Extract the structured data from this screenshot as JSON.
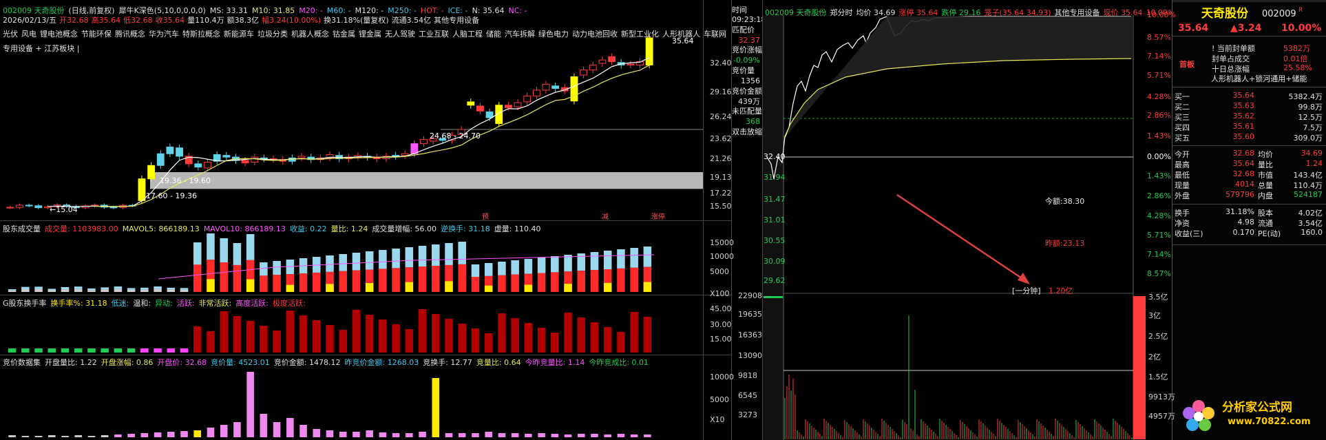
{
  "kline": {
    "header_line1": [
      "002009 天奇股份",
      "(日线,前复权)",
      "犀牛K深色(5,10,0,0,0,0)",
      "MS: 33.31",
      "M10: 31.85",
      "M20: -",
      "M60: -",
      "M120: -",
      "M250: -",
      "HOT: -",
      "ICE: -",
      "N: 35.64",
      "NC: -"
    ],
    "header_line2": [
      "2026/02/13/五",
      "开32.68",
      "高35.64",
      "低32.68",
      "收35.64",
      "量110.4万",
      "额38.3亿",
      "幅3.24(10.00%)",
      "换31.18%(量复权)",
      "流通3.54亿",
      "其他专用设备"
    ],
    "concepts": [
      "光伏",
      "风电",
      "锂电池概念",
      "节能环保",
      "腾讯概念",
      "华为汽车",
      "特斯拉概念",
      "新能源车",
      "垃圾分类",
      "机器人概念",
      "钴金属",
      "锂金属",
      "无人驾驶",
      "工业互联",
      "人脑工程",
      "储能",
      "汽车拆解",
      "绿色电力",
      "动力电池回收",
      "新型工业化",
      "人形机器人",
      "车联网"
    ],
    "concepts2": "专用设备 + 江苏板块 |",
    "price_axis": [
      "32.40",
      "29.16",
      "26.24",
      "23.62",
      "21.26",
      "19.13",
      "17.22",
      "15.50"
    ],
    "annotations": {
      "hi": "35.64",
      "lo": "15.04",
      "zone1": "24.68 - 24.70",
      "zone2": "19.36 - 19.60",
      "zone3": "17.60 - 19.36"
    },
    "markers": [
      "预",
      "减",
      "涨停"
    ],
    "colors": {
      "up": "#ff3b3b",
      "down": "#5fd3e8",
      "limit": "#ffff00",
      "ma5": "#ffffff",
      "ma10": "#e8e85a"
    }
  },
  "volume": {
    "title": [
      "股东成交量",
      "成交量: 1103983.00",
      "MAVOL5: 866189.13",
      "MAVOL10: 866189.13",
      "收益: 0.22",
      "量比: 1.24",
      "成交量增幅: 56.00",
      "逆换手: 31.18",
      "虚量: 110.40"
    ],
    "axis": [
      "15000",
      "10000",
      "5000",
      "X100"
    ]
  },
  "turnover": {
    "title": [
      "G股东换手率",
      "换手率%: 31.18",
      "低迷:",
      "温和:",
      "异动:",
      "活跃:",
      "非常活跃:",
      "高度活跃:",
      "极度活跃:"
    ],
    "axis": [
      "45.00",
      "30.00",
      "15.00"
    ]
  },
  "auction": {
    "title": [
      "竞价数据集",
      "开盘量比: 1.22",
      "开盘涨幅: 0.86",
      "开盘价: 32.68",
      "竞价量: 4523.01",
      "竞价金额: 1478.12",
      "昨竞价金额: 1268.03",
      "竞换手: 12.77",
      "竞量比: 0.64",
      "今昨竞量比: 1.14",
      "今昨竞成比: 0.01"
    ],
    "axis": [
      "10000",
      "5000",
      "X10"
    ]
  },
  "auction_panel": {
    "time_label": "时间",
    "time": "09:23:18",
    "items": [
      {
        "k": "匹配价",
        "v": "32.37"
      },
      {
        "k": "竞价涨幅",
        "v": "-0.09%"
      },
      {
        "k": "竞价量",
        "v": "1356"
      },
      {
        "k": "竞价金额",
        "v": "439万"
      },
      {
        "k": "未匹配量",
        "v": "368"
      },
      {
        "k": "双击放缩",
        "v": ""
      }
    ]
  },
  "intraday": {
    "header": [
      "002009 天奇股份",
      "郑分时",
      "均价 34.69",
      "涨停 35.64",
      "跌停 29.16",
      "笼子(35.64 34.93)",
      "其他专用设备",
      "现价 35.64",
      "10.00%",
      "▲3.24"
    ],
    "left_axis": [
      "32.40",
      "31.94",
      "31.47",
      "31.01",
      "30.55",
      "30.09",
      "29.62"
    ],
    "pct_up": [
      "10.00%",
      "8.57%",
      "7.14%",
      "5.71%",
      "4.28%",
      "2.86%",
      "1.43%"
    ],
    "pct_zero": "0.00%",
    "pct_down": [
      "1.43%",
      "2.86%",
      "4.28%",
      "5.71%",
      "7.14%",
      "8.57%"
    ],
    "vol_axis": [
      "22908",
      "19635",
      "16363",
      "13090",
      "9818",
      "6545",
      "3273"
    ],
    "amt_axis": [
      "3.5亿",
      "3亿",
      "2.5亿",
      "2亿",
      "1.5亿",
      "9913万",
      "4957万"
    ],
    "notes": {
      "today_amt": "今额:38.30",
      "yest_amt": "昨额:23.13",
      "minute_label": "[一分钟]",
      "minute_val": "1.20亿"
    }
  },
  "quote": {
    "name": "天奇股份",
    "code": "002009",
    "tag": "R",
    "price": "35.64",
    "change": "▲3.24",
    "pct": "10.00%",
    "board_label": "首板",
    "board_info": [
      {
        "k": "! 当前封单额",
        "v": "5382万"
      },
      {
        "k": "封单占成交",
        "v": "0.01倍"
      },
      {
        "k": "十日总涨幅",
        "v": "25.58%"
      }
    ],
    "board_concept": "人形机器人+锁河通用+储能",
    "book": [
      {
        "k": "买一",
        "p": "35.64",
        "v": "5382.4万"
      },
      {
        "k": "买二",
        "p": "35.63",
        "v": "99.8万"
      },
      {
        "k": "买三",
        "p": "35.62",
        "v": "12.5万"
      },
      {
        "k": "买四",
        "p": "35.61",
        "v": "7.5万"
      },
      {
        "k": "买五",
        "p": "35.60",
        "v": "309.0万"
      }
    ],
    "stats": [
      {
        "k1": "今开",
        "v1": "32.68",
        "k2": "均价",
        "v2": "34.69"
      },
      {
        "k1": "最高",
        "v1": "35.64",
        "k2": "量比",
        "v2": "1.24"
      },
      {
        "k1": "最低",
        "v1": "32.68",
        "k2": "市值",
        "v2": "143.4亿"
      },
      {
        "k1": "现量",
        "v1": "4014",
        "k2": "总量",
        "v2": "110.4万"
      },
      {
        "k1": "外盘",
        "v1": "579796",
        "k2": "内盘",
        "v2": "524187"
      }
    ],
    "stats2": [
      {
        "k1": "换手",
        "v1": "31.18%",
        "k2": "股本",
        "v2": "4.02亿"
      },
      {
        "k1": "净资",
        "v1": "4.98",
        "k2": "流通",
        "v2": "3.54亿"
      },
      {
        "k1": "收益(三)",
        "v1": "0.170",
        "k2": "PE(动)",
        "v2": "160.0"
      }
    ],
    "logo_text": "分析家公式网",
    "logo_url": "www.70822.com"
  }
}
